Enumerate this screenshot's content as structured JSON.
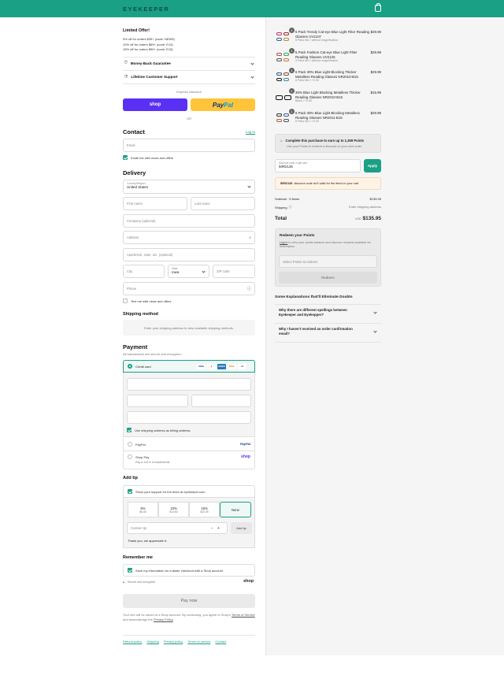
{
  "header": {
    "logo": "EYEKEEPER",
    "bg_color": "#1aa085",
    "cart_icon": "shopping-bag-icon"
  },
  "offer": {
    "title": "Limited Offer!",
    "lines": [
      "5% off for orders $39+ (code: NEW5)",
      "10% off for orders $69+ (code: E10)",
      "15% off for orders $99+ (code: E15)"
    ]
  },
  "accordion": {
    "guarantee": "Money-Back Guarantee",
    "support": "Lifetime Customer Support"
  },
  "express": {
    "label": "Express checkout",
    "shop": "shop",
    "paypal_a": "Pay",
    "paypal_b": "Pal",
    "or": "OR"
  },
  "contact": {
    "title": "Contact",
    "login": "Log in",
    "email_placeholder": "Email",
    "news_label": "Email me with news and offers"
  },
  "delivery": {
    "title": "Delivery",
    "country_label": "Country/Region",
    "country_value": "United States",
    "first_name": "First name",
    "last_name": "Last name",
    "company": "Company (optional)",
    "address": "Address",
    "apartment": "Apartment, suite, etc. (optional)",
    "city": "City",
    "state_label": "State",
    "state_value": "Iowa",
    "zip": "ZIP code",
    "phone": "Phone",
    "text_label": "Text me with news and offers"
  },
  "shipping": {
    "title": "Shipping method",
    "message": "Enter your shipping address to view available shipping methods."
  },
  "payment": {
    "title": "Payment",
    "subtitle": "All transactions are secure and encrypted.",
    "credit_card": "Credit card",
    "card_brands": [
      "VISA",
      "MC",
      "AMEX",
      "DISC",
      "+5"
    ],
    "billing_label": "Use shipping address as billing address",
    "paypal": "PayPal",
    "paypal_logo": "PayPal",
    "shoppay": "Shop Pay",
    "shoppay_sub": "Pay in full or in installments",
    "shoppay_logo": "shop"
  },
  "tip": {
    "title": "Add tip",
    "support_label": "Show your support for the team at eyekeeper.com",
    "options": [
      {
        "pct": "5%",
        "amt": "$6.80"
      },
      {
        "pct": "10%",
        "amt": "$13.60"
      },
      {
        "pct": "15%",
        "amt": "$20.39"
      },
      {
        "pct": "None",
        "amt": ""
      }
    ],
    "custom_placeholder": "Custom tip",
    "minus": "−",
    "plus": "+",
    "add_button": "Add tip",
    "thanks": "Thank you, we appreciate it."
  },
  "remember": {
    "title": "Remember me",
    "label": "Save my information for a faster checkout with a Shop account",
    "secure": "Secure and encrypted",
    "shop": "shop"
  },
  "pay_button": "Pay now",
  "legal": {
    "text_a": "Your info will be saved to a Shop account. By continuing, you agree to Shop's",
    "tos": "Terms of Service",
    "text_b": "and acknowledge the",
    "privacy": "Privacy Policy",
    "end": "."
  },
  "footer_links": [
    "Refund policy",
    "Shipping",
    "Privacy policy",
    "Terms of service",
    "Contact"
  ],
  "cart": {
    "items": [
      {
        "qty": "1",
        "name": "5 Pack Trendy Cat-eye Blue Light Filter Reading Glasses UV2107",
        "sub": "5 Pairs Mix / without magnification",
        "price": "$29.99"
      },
      {
        "qty": "1",
        "name": "5 Pack Fashion Cat-eye Blue Light Filter Reading Glasses UV2126",
        "sub": "5 Pairs Mix / without magnification",
        "price": "$29.99"
      },
      {
        "qty": "1",
        "name": "6 Pack 30% Blue Light Blocking Thicker Metalless Reading Glasses NR2010-B15",
        "sub": "6 Pairs Mix / +0.00",
        "price": "$29.99"
      },
      {
        "qty": "1",
        "name": "30% Blue Light Blocking Metalless Thicker Reading Glasses NR2010-B15",
        "sub": "Black / +0.00",
        "price": "$15.99"
      },
      {
        "qty": "1",
        "name": "6 Pack 30% Blue Light Blocking Metalless Reading Glasses NR2011-B15",
        "sub": "6 Pairs Mix / +0.00",
        "price": "$29.99"
      }
    ],
    "points_title": "Complete this purchase to earn up to 1,359 Points",
    "points_sub": "Use your Points to redeem a discount on your next order.",
    "discount_label": "Discount code or gift card",
    "discount_value": "50R2126",
    "apply": "Apply",
    "discount_error_code": "50R2126",
    "discount_error_text": "discount code isn't valid for the items in your cart",
    "subtotal_label": "Subtotal · 5 items",
    "subtotal_value": "$135.95",
    "shipping_label": "Shipping",
    "shipping_value": "Enter shipping address",
    "total_label": "Total",
    "currency": "USD",
    "total_value": "$135.95",
    "redeem_title": "Redeem your Points",
    "redeem_login": "Log in",
    "redeem_text": "to view your points balance and discover rewards available for redemption.",
    "redeem_select": "Select Points to redeem",
    "redeem_button": "Redeem",
    "faq_title": "Some Explanations that'll Eliminate Doubts",
    "faq": [
      "Why there are different spellings between Eyekeeper and Eyekepper?",
      "Why I haven't received an order confirmation email?"
    ]
  }
}
